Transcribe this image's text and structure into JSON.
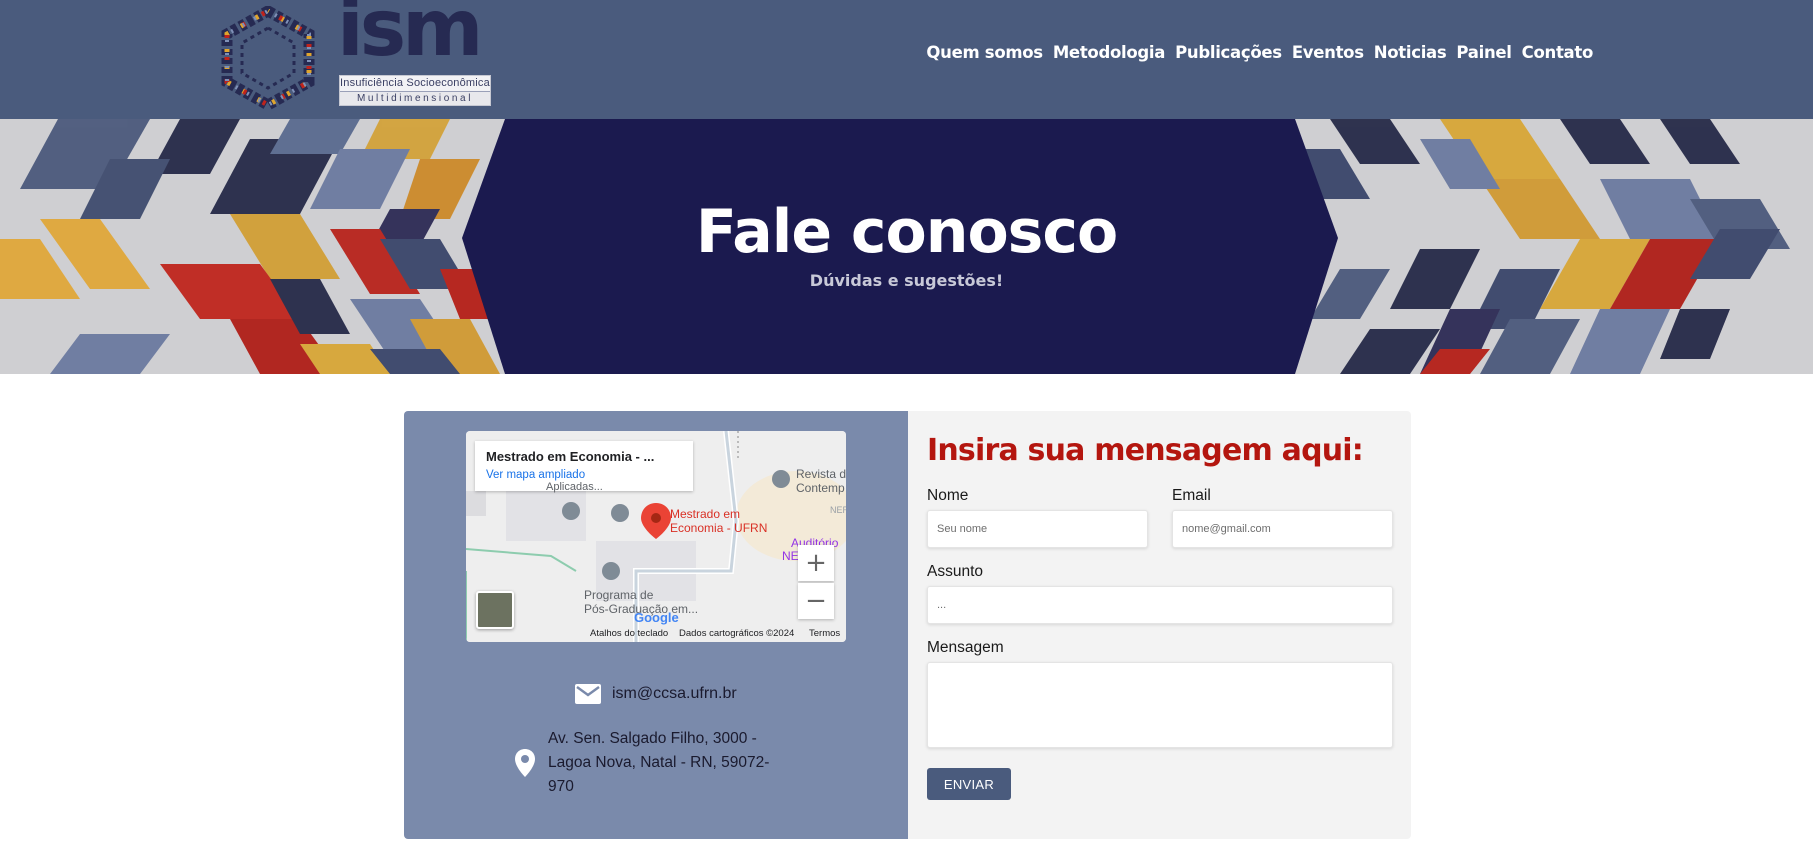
{
  "header": {
    "logo": {
      "wordmark": "ism",
      "subtitle_line1": "Insuficiência Socioeconômica",
      "subtitle_line2": "Multidimensional"
    },
    "nav": [
      {
        "label": "Quem somos"
      },
      {
        "label": "Metodologia"
      },
      {
        "label": "Publicações"
      },
      {
        "label": "Eventos"
      },
      {
        "label": "Noticias"
      },
      {
        "label": "Painel"
      },
      {
        "label": "Contato"
      }
    ]
  },
  "hero": {
    "title": "Fale conosco",
    "subtitle": "Dúvidas e sugestões!"
  },
  "map": {
    "place_title": "Mestrado em Economia - ...",
    "enlarge_link": "Ver mapa ampliado",
    "pin_label_1": "Mestrado em",
    "pin_label_2": "Economia - UFRN",
    "poi_top_left": "Aplicadas...",
    "poi_revista_1": "Revista d",
    "poi_revista_2": "Contemp",
    "poi_ner": "NER",
    "poi_auditorio_1": "Auditório",
    "poi_auditorio_2": "NE",
    "poi_programa_1": "Programa de",
    "poi_programa_2": "Pós-Graduação em...",
    "google_logo": "Google",
    "zoom_in": "+",
    "zoom_out": "−",
    "footer_shortcuts": "Atalhos do teclado",
    "footer_data": "Dados cartográficos ©2024",
    "footer_terms": "Termos"
  },
  "contact": {
    "email": "ism@ccsa.ufrn.br",
    "address": "Av. Sen. Salgado Filho, 3000 - Lagoa Nova, Natal - RN, 59072-970"
  },
  "form": {
    "title": "Insira sua mensagem aqui:",
    "name_label": "Nome",
    "name_placeholder": "Seu nome",
    "email_label": "Email",
    "email_placeholder": "nome@gmail.com",
    "subject_label": "Assunto",
    "subject_placeholder": "...",
    "message_label": "Mensagem",
    "message_placeholder": "",
    "submit_label": "ENVIAR"
  },
  "colors": {
    "header_bg": "#4a5b7d",
    "hero_hexagon": "#1b1a4f",
    "card_left_bg": "#7a8aab",
    "card_right_bg": "#f3f3f3",
    "form_title": "#b4160f",
    "button_bg": "#4a5b7d"
  },
  "icons": {
    "email": "envelope-icon",
    "address": "map-pin-icon",
    "map_pin": "map-marker-icon"
  }
}
